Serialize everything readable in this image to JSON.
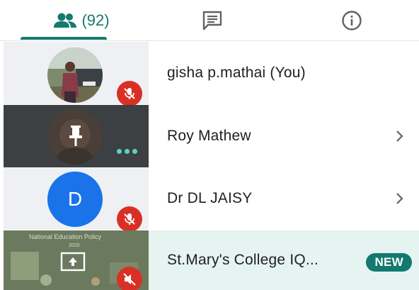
{
  "tabs": {
    "people_count": "(92)",
    "people_icon": "people-icon",
    "chat_icon": "chat-icon",
    "info_icon": "info-icon"
  },
  "participants": [
    {
      "name": "gisha p.mathai (You)",
      "status": "muted",
      "icon": "mic-off-icon"
    },
    {
      "name": "Roy Mathew",
      "status": "pinned",
      "icon": "pin-icon"
    },
    {
      "name": "Dr DL JAISY",
      "avatar_letter": "D",
      "status": "muted",
      "icon": "mic-off-icon"
    },
    {
      "name": "St.Mary's College IQ...",
      "badge": "NEW",
      "status": "presenting",
      "icon": "present-screen-icon",
      "slide_heading": "National Education Policy",
      "slide_year": "2020"
    }
  ],
  "colors": {
    "accent": "#137a6f",
    "mute": "#d93025",
    "avatar_blue": "#1a73e8",
    "highlight_row": "#e6f4f1"
  }
}
